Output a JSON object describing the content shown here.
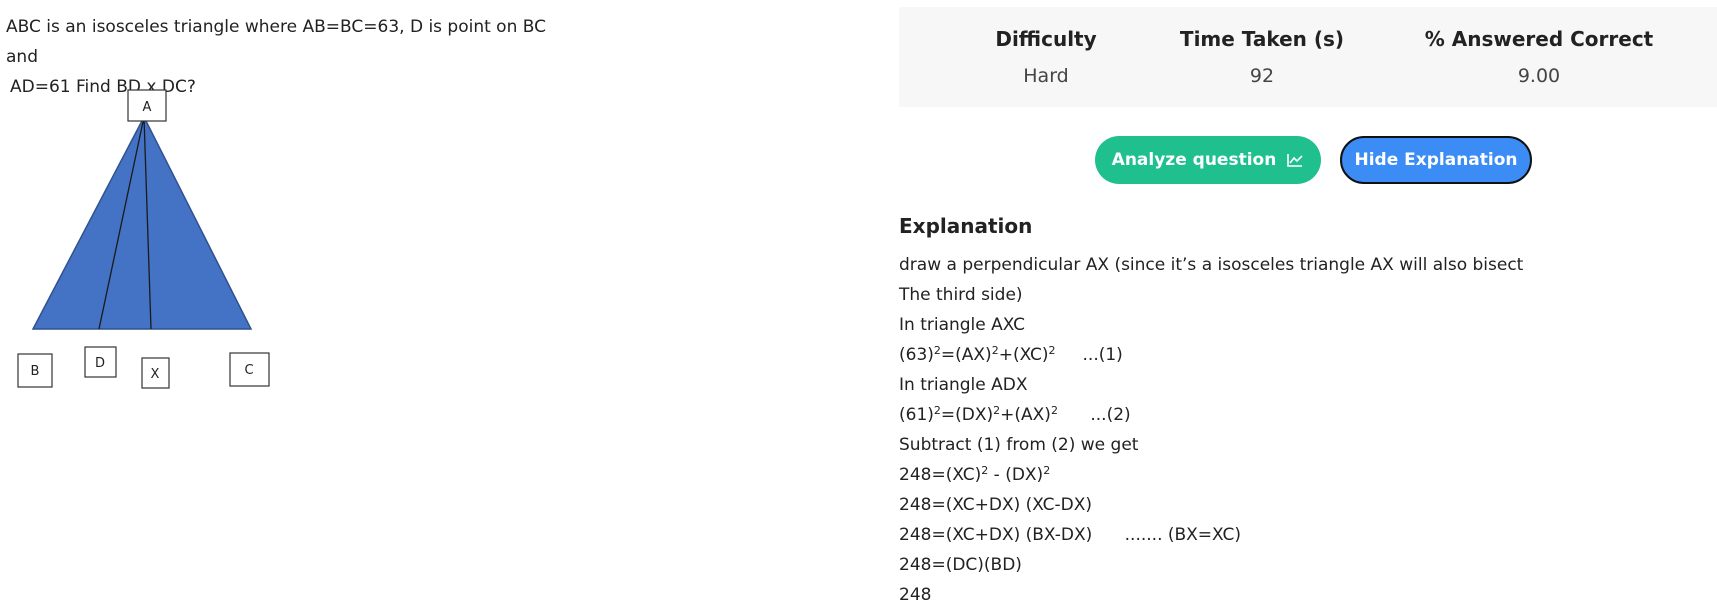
{
  "question": {
    "line1": "ABC is an isosceles triangle where AB=BC=63, D is point on BC and",
    "line2": "AD=61 Find BD x DC?"
  },
  "diagram": {
    "labels": {
      "a": "A",
      "b": "B",
      "d": "D",
      "x": "X",
      "c": "C"
    },
    "fill_color": "#4472c4"
  },
  "stats": {
    "headers": [
      "Difficulty",
      "Time Taken (s)",
      "% Answered Correct"
    ],
    "values": [
      "Hard",
      "92",
      "9.00"
    ]
  },
  "buttons": {
    "analyze_label": "Analyze question",
    "analyze_icon": "chart-line-icon",
    "hide_label": "Hide Explanation",
    "analyze_color": "#1fc08e",
    "hide_color": "#3b8cf5"
  },
  "explanation": {
    "title": "Explanation",
    "lines": [
      "draw a perpendicular AX (since it’s a isosceles triangle AX will also bisect",
      "The third side)",
      "In triangle AXC",
      {
        "base": "(63)",
        "s1": "2",
        "mid1": "=(AX)",
        "s2": "2",
        "mid2": "+(XC)",
        "s3": "2",
        "tail": "     ...(1)"
      },
      "In triangle ADX",
      {
        "base": "(61)",
        "s1": "2",
        "mid1": "=(DX)",
        "s2": "2",
        "mid2": "+(AX)",
        "s3": "2",
        "tail": "      ...(2)"
      },
      "Subtract (1) from (2) we get",
      {
        "base": "248=(XC)",
        "s1": "2",
        "mid1": " - (DX)",
        "s2": "2"
      },
      "248=(XC+DX) (XC-DX)",
      "248=(XC+DX) (BX-DX)      ....... (BX=XC)",
      "248=(DC)(BD)",
      "248"
    ]
  }
}
